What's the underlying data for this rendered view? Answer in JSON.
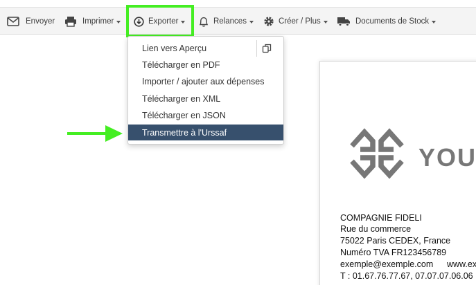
{
  "toolbar": {
    "send": "Envoyer",
    "print": "Imprimer",
    "export": "Exporter",
    "reminders": "Relances",
    "create_more": "Créer / Plus",
    "stock_docs": "Documents de Stock"
  },
  "export_menu": {
    "items": [
      "Lien vers Aperçu",
      "Télécharger en PDF",
      "Importer / ajouter aux dépenses",
      "Télécharger en XML",
      "Télécharger en JSON",
      "Transmettre à l'Urssaf"
    ],
    "active_item": "Transmettre à l'Urssaf"
  },
  "document": {
    "logo_text": "YOUR",
    "company": "COMPAGNIE FIDELI",
    "street": "Rue du commerce",
    "city": "75022 Paris CEDEX, France",
    "vat": "Numéro TVA FR123456789",
    "email": "exemple@exemple.com",
    "web": "www.ex",
    "phones": "T : 01.67.76.77.67, 07.07.07.06.06"
  },
  "colors": {
    "highlight": "#44ee22",
    "active_item_bg": "#37506d",
    "arrow": "#44ee22"
  }
}
